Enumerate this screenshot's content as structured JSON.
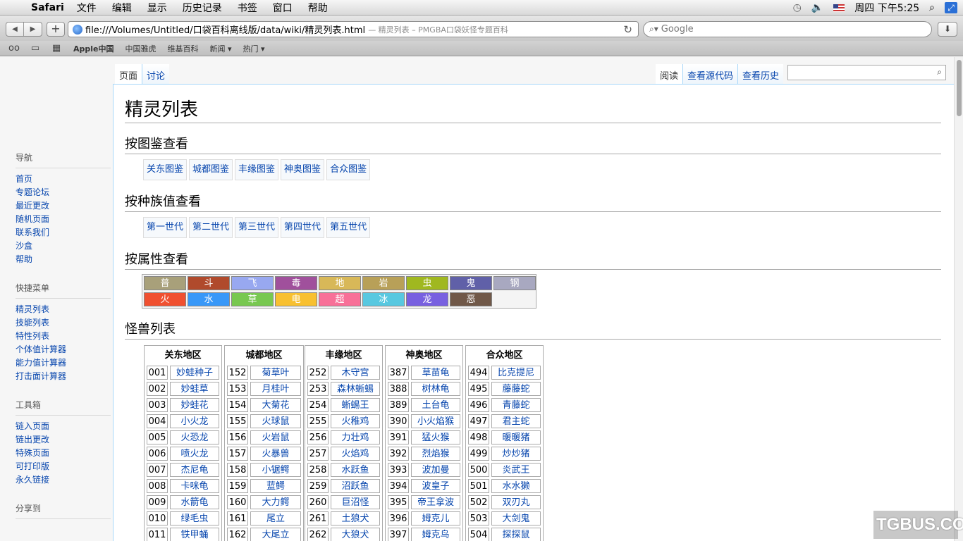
{
  "menubar": {
    "app": "Safari",
    "items": [
      "文件",
      "编辑",
      "显示",
      "历史记录",
      "书签",
      "窗口",
      "帮助"
    ],
    "clock": "周四 下午5:25"
  },
  "toolbar": {
    "url": "file:///Volumes/Untitled/口袋百科离线版/data/wiki/精灵列表.html",
    "page_title": "— 精灵列表 – PMGBA口袋妖怪专题百科",
    "search_placeholder": "Google"
  },
  "bookmarks": [
    "Apple中国",
    "中国雅虎",
    "维基百科",
    "新闻 ▾",
    "热门 ▾"
  ],
  "tabs": {
    "left": [
      "页面",
      "讨论"
    ],
    "right": [
      "阅读",
      "查看源代码",
      "查看历史"
    ]
  },
  "sidebar": {
    "nav": {
      "title": "导航",
      "links": [
        "首页",
        "专题论坛",
        "最近更改",
        "随机页面",
        "联系我们",
        "沙盒",
        "帮助"
      ]
    },
    "quick": {
      "title": "快捷菜单",
      "links": [
        "精灵列表",
        "技能列表",
        "特性列表",
        "个体值计算器",
        "能力值计算器",
        "打击面计算器"
      ]
    },
    "tools": {
      "title": "工具箱",
      "links": [
        "链入页面",
        "链出更改",
        "特殊页面",
        "可打印版",
        "永久链接"
      ]
    },
    "share": {
      "title": "分享到"
    }
  },
  "page": {
    "title": "精灵列表",
    "sec_dex": "按图鉴查看",
    "dex_links": [
      "关东图鉴",
      "城都图鉴",
      "丰缘图鉴",
      "神奥图鉴",
      "合众图鉴"
    ],
    "sec_gen": "按种族值查看",
    "gen_links": [
      "第一世代",
      "第二世代",
      "第三世代",
      "第四世代",
      "第五世代"
    ],
    "sec_type": "按属性查看",
    "types": [
      {
        "label": "普",
        "color": "#a8a07a"
      },
      {
        "label": "斗",
        "color": "#b04a2c"
      },
      {
        "label": "飞",
        "color": "#98a8f0"
      },
      {
        "label": "毒",
        "color": "#a0509c"
      },
      {
        "label": "地",
        "color": "#d8b858"
      },
      {
        "label": "岩",
        "color": "#b8a058"
      },
      {
        "label": "虫",
        "color": "#a0b820"
      },
      {
        "label": "鬼",
        "color": "#6060a8"
      },
      {
        "label": "钢",
        "color": "#a8a8c0"
      },
      {
        "label": "火",
        "color": "#f05030"
      },
      {
        "label": "水",
        "color": "#3898f8"
      },
      {
        "label": "草",
        "color": "#78c850"
      },
      {
        "label": "电",
        "color": "#f8c030"
      },
      {
        "label": "超",
        "color": "#f87098"
      },
      {
        "label": "冰",
        "color": "#58c8e0"
      },
      {
        "label": "龙",
        "color": "#7860e0"
      },
      {
        "label": "恶",
        "color": "#705848"
      }
    ],
    "sec_list": "怪兽列表",
    "regions": [
      {
        "name": "关东地区",
        "entries": [
          [
            "001",
            "妙蛙种子"
          ],
          [
            "002",
            "妙蛙草"
          ],
          [
            "003",
            "妙蛙花"
          ],
          [
            "004",
            "小火龙"
          ],
          [
            "005",
            "火恐龙"
          ],
          [
            "006",
            "喷火龙"
          ],
          [
            "007",
            "杰尼龟"
          ],
          [
            "008",
            "卡咪龟"
          ],
          [
            "009",
            "水箭龟"
          ],
          [
            "010",
            "绿毛虫"
          ],
          [
            "011",
            "铁甲蛹"
          ]
        ]
      },
      {
        "name": "城都地区",
        "entries": [
          [
            "152",
            "菊草叶"
          ],
          [
            "153",
            "月桂叶"
          ],
          [
            "154",
            "大菊花"
          ],
          [
            "155",
            "火球鼠"
          ],
          [
            "156",
            "火岩鼠"
          ],
          [
            "157",
            "火暴兽"
          ],
          [
            "158",
            "小锯鳄"
          ],
          [
            "159",
            "蓝鳄"
          ],
          [
            "160",
            "大力鳄"
          ],
          [
            "161",
            "尾立"
          ],
          [
            "162",
            "大尾立"
          ]
        ]
      },
      {
        "name": "丰缘地区",
        "entries": [
          [
            "252",
            "木守宫"
          ],
          [
            "253",
            "森林蜥蜴"
          ],
          [
            "254",
            "蜥蜴王"
          ],
          [
            "255",
            "火稚鸡"
          ],
          [
            "256",
            "力壮鸡"
          ],
          [
            "257",
            "火焰鸡"
          ],
          [
            "258",
            "水跃鱼"
          ],
          [
            "259",
            "沼跃鱼"
          ],
          [
            "260",
            "巨沼怪"
          ],
          [
            "261",
            "土狼犬"
          ],
          [
            "262",
            "大狼犬"
          ]
        ]
      },
      {
        "name": "神奥地区",
        "entries": [
          [
            "387",
            "草苗龟"
          ],
          [
            "388",
            "树林龟"
          ],
          [
            "389",
            "土台龟"
          ],
          [
            "390",
            "小火焰猴"
          ],
          [
            "391",
            "猛火猴"
          ],
          [
            "392",
            "烈焰猴"
          ],
          [
            "393",
            "波加曼"
          ],
          [
            "394",
            "波皇子"
          ],
          [
            "395",
            "帝王拿波"
          ],
          [
            "396",
            "姆克儿"
          ],
          [
            "397",
            "姆克鸟"
          ]
        ]
      },
      {
        "name": "合众地区",
        "entries": [
          [
            "494",
            "比克提尼"
          ],
          [
            "495",
            "藤藤蛇"
          ],
          [
            "496",
            "青藤蛇"
          ],
          [
            "497",
            "君主蛇"
          ],
          [
            "498",
            "暖暖猪"
          ],
          [
            "499",
            "炒炒猪"
          ],
          [
            "500",
            "炎武王"
          ],
          [
            "501",
            "水水獭"
          ],
          [
            "502",
            "双刃丸"
          ],
          [
            "503",
            "大剑鬼"
          ],
          [
            "504",
            "探探鼠"
          ]
        ]
      }
    ]
  },
  "watermark": "TGBUS.COM"
}
